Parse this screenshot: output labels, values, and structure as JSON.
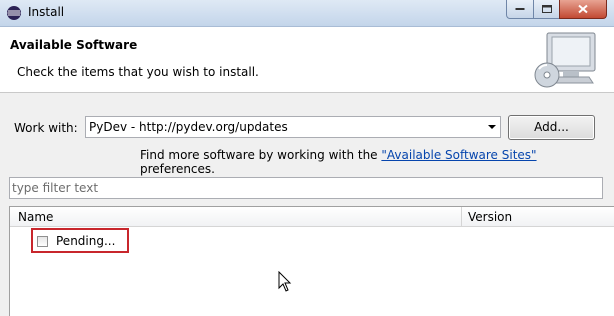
{
  "window": {
    "title": "Install",
    "icon": "eclipse-icon"
  },
  "header": {
    "title": "Available Software",
    "description": "Check the items that you wish to install.",
    "graphic": "monitor-cd-icon"
  },
  "work_with": {
    "label": "Work with:",
    "value": "PyDev - http://pydev.org/updates",
    "add_label": "Add..."
  },
  "hint": {
    "prefix": "Find more software by working with the ",
    "link": "\"Available Software Sites\"",
    "suffix": " preferences."
  },
  "filter": {
    "placeholder": "type filter text"
  },
  "table": {
    "columns": [
      "Name",
      "Version"
    ],
    "rows": [
      {
        "name": "Pending...",
        "checked": false
      }
    ]
  },
  "colors": {
    "highlight": "#c8262c",
    "link": "#0645ad"
  }
}
